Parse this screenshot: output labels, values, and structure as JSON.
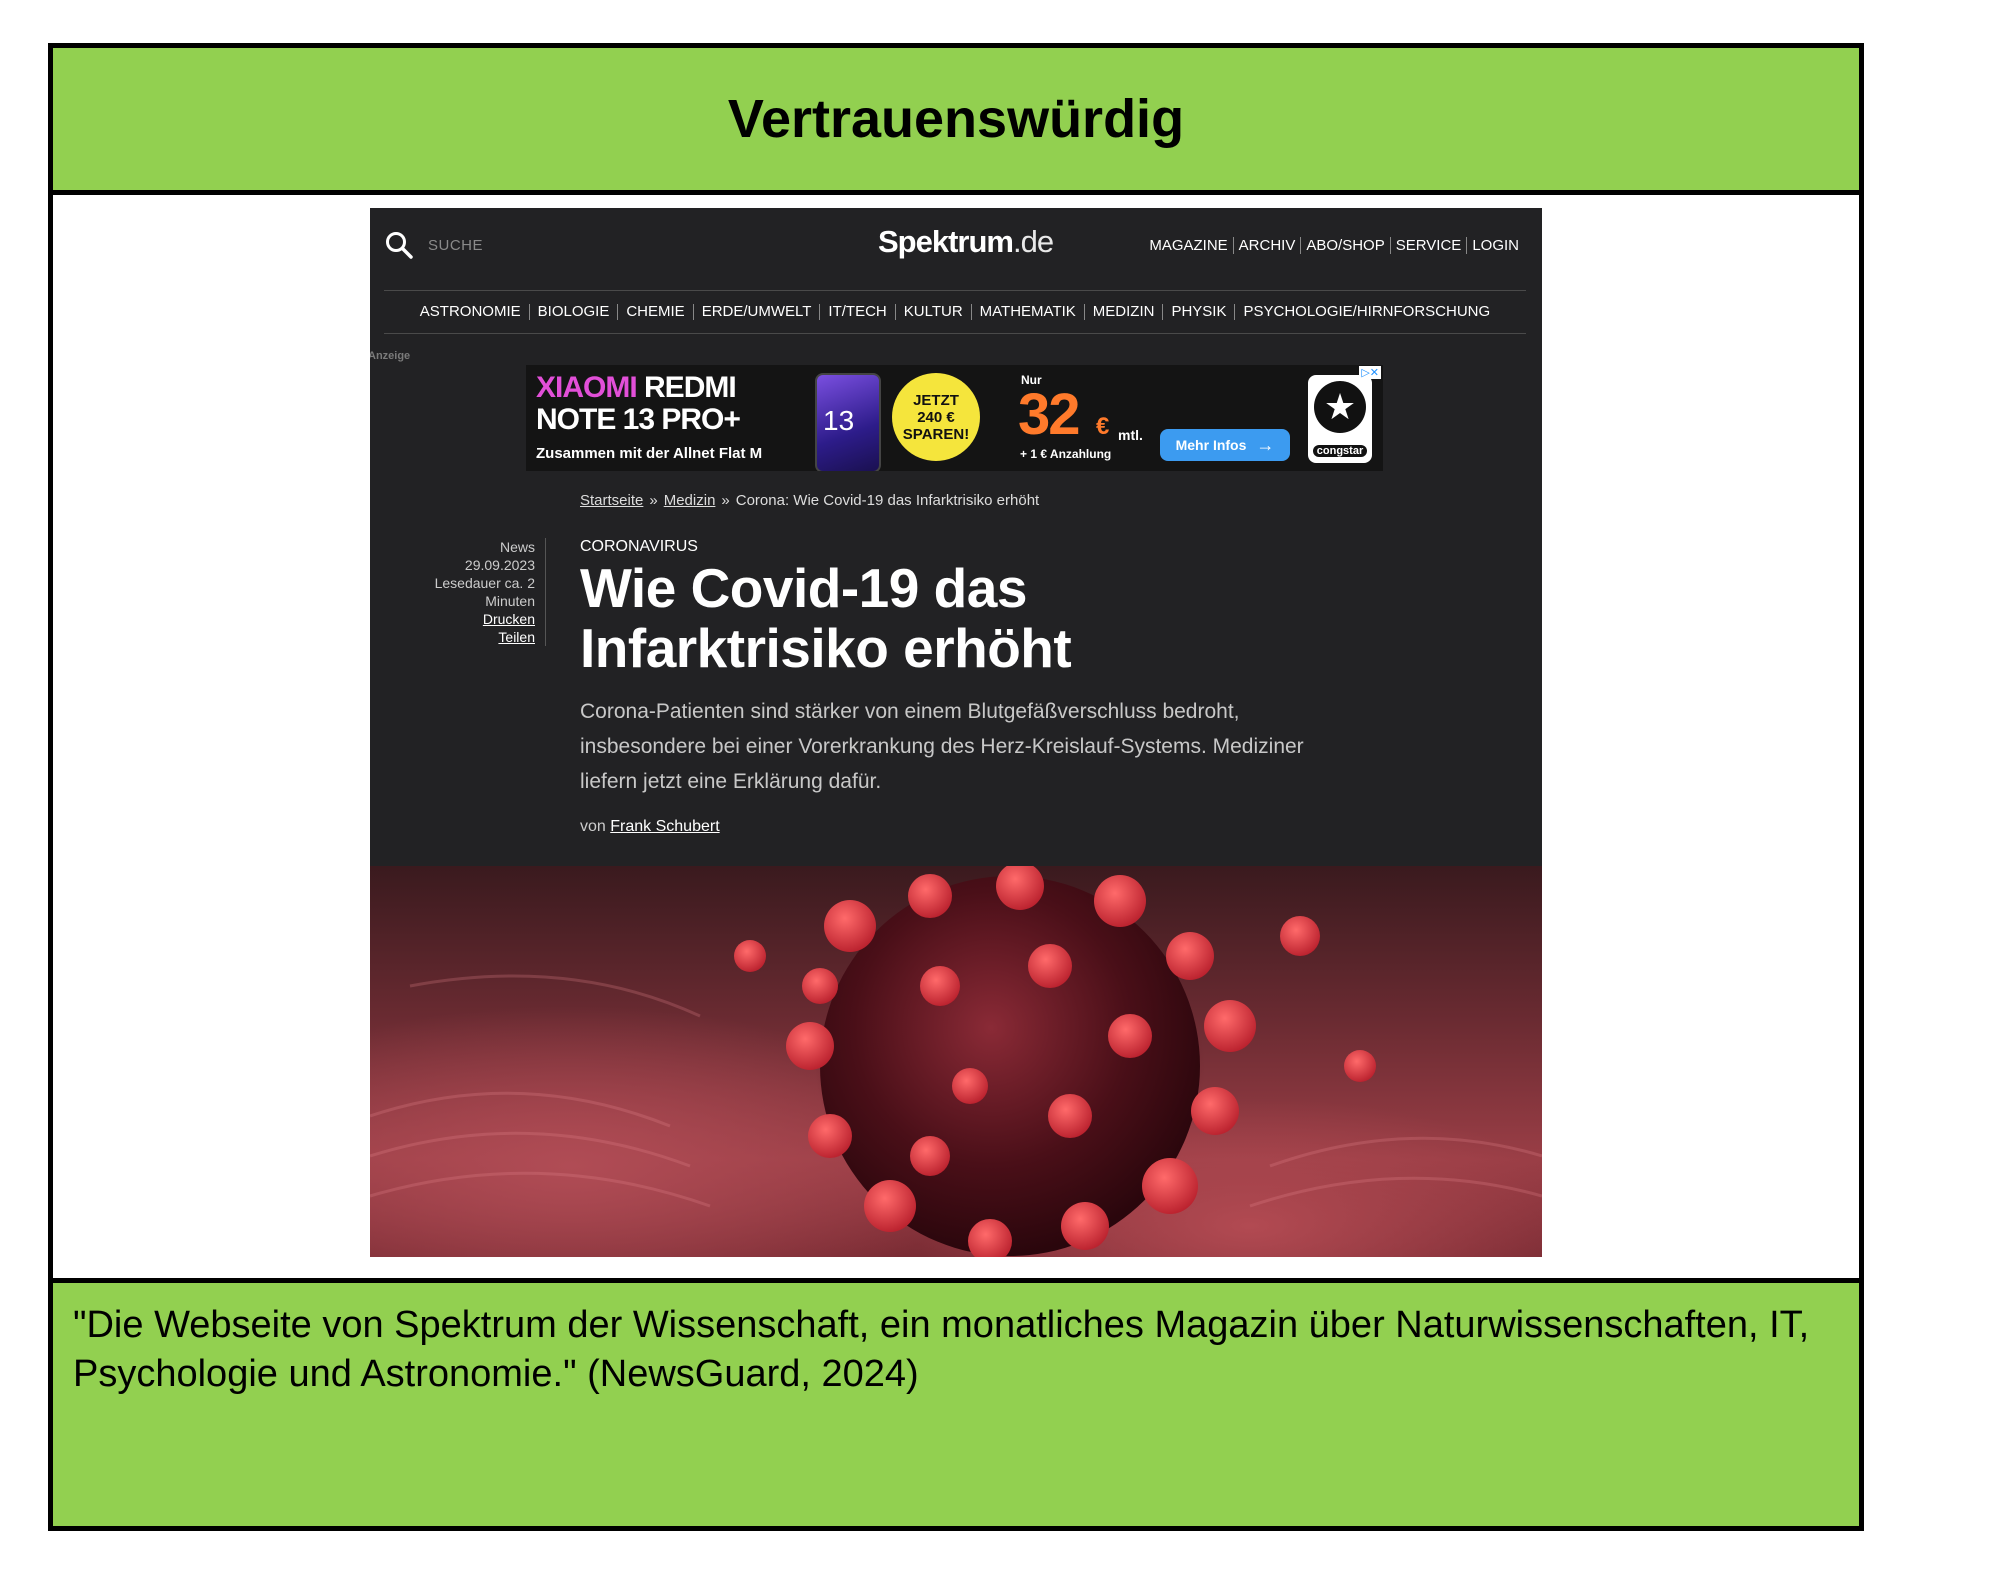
{
  "header": {
    "title": "Vertrauenswürdig"
  },
  "site": {
    "search_label": "SUCHE",
    "logo_main": "Spektrum",
    "logo_tld": ".de",
    "top_nav": [
      "MAGAZINE",
      "ARCHIV",
      "ABO/SHOP",
      "SERVICE",
      "LOGIN"
    ],
    "categories": [
      "ASTRONOMIE",
      "BIOLOGIE",
      "CHEMIE",
      "ERDE/UMWELT",
      "IT/TECH",
      "KULTUR",
      "MATHEMATIK",
      "MEDIZIN",
      "PHYSIK",
      "PSYCHOLOGIE/HIRNFORSCHUNG"
    ],
    "ad_label": "Anzeige"
  },
  "ad": {
    "brand_a": "XIAOMI",
    "brand_b": "REDMI",
    "model": "NOTE 13 PRO+",
    "tagline": "Zusammen mit der Allnet Flat M",
    "phone_number": "13",
    "badge_lines": [
      "JETZT",
      "240 €",
      "SPAREN!"
    ],
    "nur": "Nur",
    "price": "32",
    "currency": "€",
    "per_month": "mtl.",
    "down_payment": "+ 1 € Anzahlung",
    "cta": "Mehr Infos",
    "advertiser": "congstar",
    "adchoices": "▷✕"
  },
  "breadcrumb": {
    "home": "Startseite",
    "section": "Medizin",
    "current": "Corona: Wie Covid-19 das Infarktrisiko erhöht",
    "separator": "»"
  },
  "meta": {
    "type": "News",
    "date": "29.09.2023",
    "reading_time_a": "Lesedauer ca. 2",
    "reading_time_b": "Minuten",
    "print": "Drucken",
    "share": "Teilen"
  },
  "article": {
    "kicker": "CORONAVIRUS",
    "title": "Wie Covid-19 das Infarktrisiko erhöht",
    "lead": "Corona-Patienten sind stärker von einem Blutgefäßverschluss bedroht, insbesondere bei einer Vorerkrankung des Herz-Kreislauf-Systems. Mediziner liefern jetzt eine Erklärung dafür.",
    "by": "von",
    "author": "Frank Schubert"
  },
  "footer": {
    "quote": "\"Die Webseite von Spektrum der Wissenschaft, ein monatliches Magazin über Naturwissenschaften, IT, Psychologie und Astronomie.\" (NewsGuard, 2024)"
  },
  "colors": {
    "label_green": "#92d050",
    "site_dark": "#222224",
    "price_orange": "#ff7a2b",
    "cta_blue": "#3c9bf0"
  },
  "icons": [
    "search-icon",
    "arrow-right-icon",
    "congstar-star-icon",
    "adchoices-icon"
  ]
}
